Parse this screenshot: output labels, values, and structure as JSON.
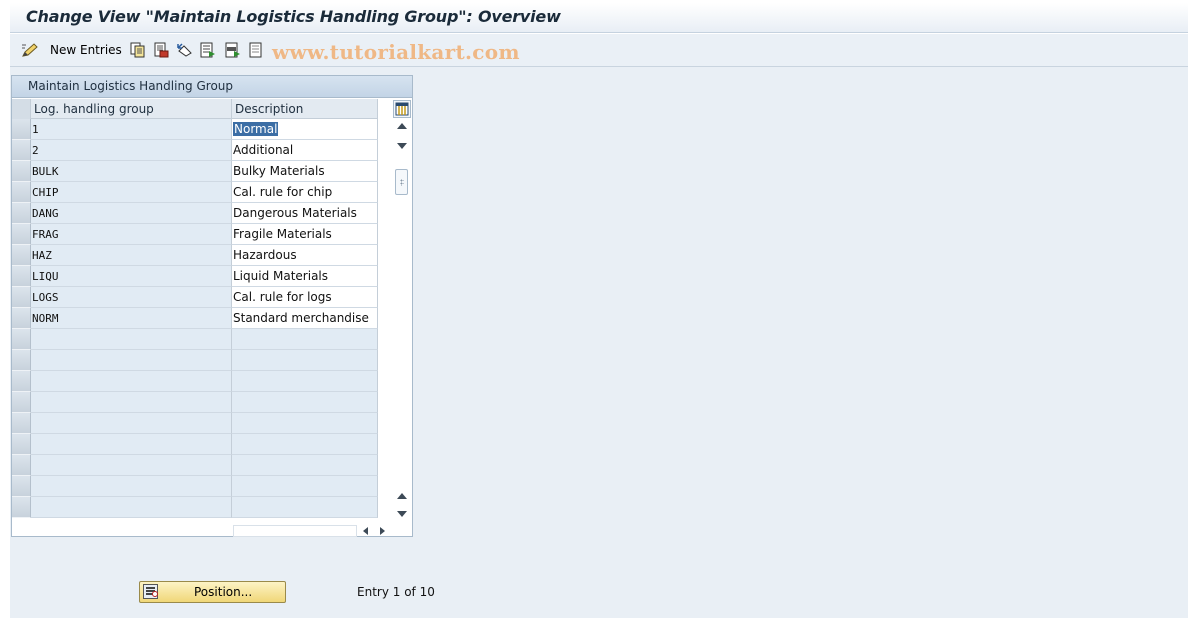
{
  "window": {
    "title": "Change View \"Maintain Logistics Handling Group\": Overview"
  },
  "toolbar": {
    "new_entries_label": "New Entries",
    "icons": [
      "edit-pen-icon",
      "copy-icon",
      "delete-icon",
      "undo-icon",
      "select-all-icon",
      "select-block-icon",
      "deselect-all-icon"
    ],
    "watermark": "www.tutorialkart.com"
  },
  "table": {
    "title": "Maintain Logistics Handling Group",
    "columns": [
      "Log. handling group",
      "Description"
    ],
    "rows": [
      {
        "code": "1",
        "description": "Normal"
      },
      {
        "code": "2",
        "description": "Additional"
      },
      {
        "code": "BULK",
        "description": "Bulky Materials"
      },
      {
        "code": "CHIP",
        "description": "Cal. rule for chip"
      },
      {
        "code": "DANG",
        "description": "Dangerous Materials"
      },
      {
        "code": "FRAG",
        "description": "Fragile Materials"
      },
      {
        "code": "HAZ",
        "description": "Hazardous"
      },
      {
        "code": "LIQU",
        "description": "Liquid Materials"
      },
      {
        "code": "LOGS",
        "description": "Cal. rule for logs"
      },
      {
        "code": "NORM",
        "description": "Standard merchandise"
      }
    ],
    "empty_rows": 9,
    "selected_cell": "Normal"
  },
  "footer": {
    "position_button": "Position...",
    "entry_info": "Entry 1 of 10"
  }
}
